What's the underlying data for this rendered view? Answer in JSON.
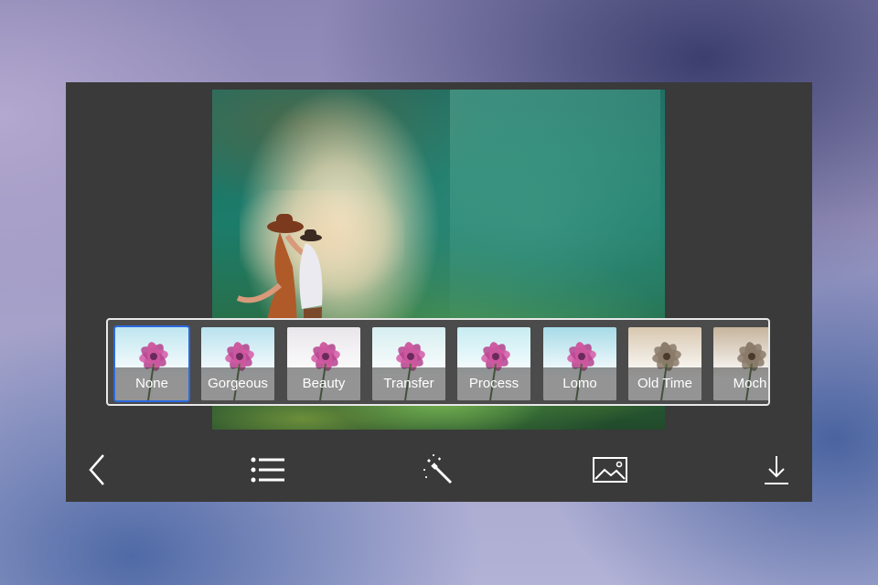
{
  "editor": {
    "filters": [
      {
        "label": "None",
        "tint": "#bfe6f0",
        "selected": true
      },
      {
        "label": "Gorgeous",
        "tint": "#b9e2ef",
        "selected": false
      },
      {
        "label": "Beauty",
        "tint": "#e9e6ea",
        "selected": false
      },
      {
        "label": "Transfer",
        "tint": "#d6eef0",
        "selected": false
      },
      {
        "label": "Process",
        "tint": "#c6ecf2",
        "selected": false
      },
      {
        "label": "Lomo",
        "tint": "#a7dbe8",
        "selected": false
      },
      {
        "label": "Old Time",
        "tint": "#d8c7b0",
        "selected": false
      },
      {
        "label": "Moch",
        "tint": "#c6b49d",
        "selected": false
      }
    ],
    "toolbar": [
      {
        "name": "back-icon"
      },
      {
        "name": "list-icon"
      },
      {
        "name": "magic-wand-icon"
      },
      {
        "name": "image-icon"
      },
      {
        "name": "download-icon"
      }
    ]
  }
}
